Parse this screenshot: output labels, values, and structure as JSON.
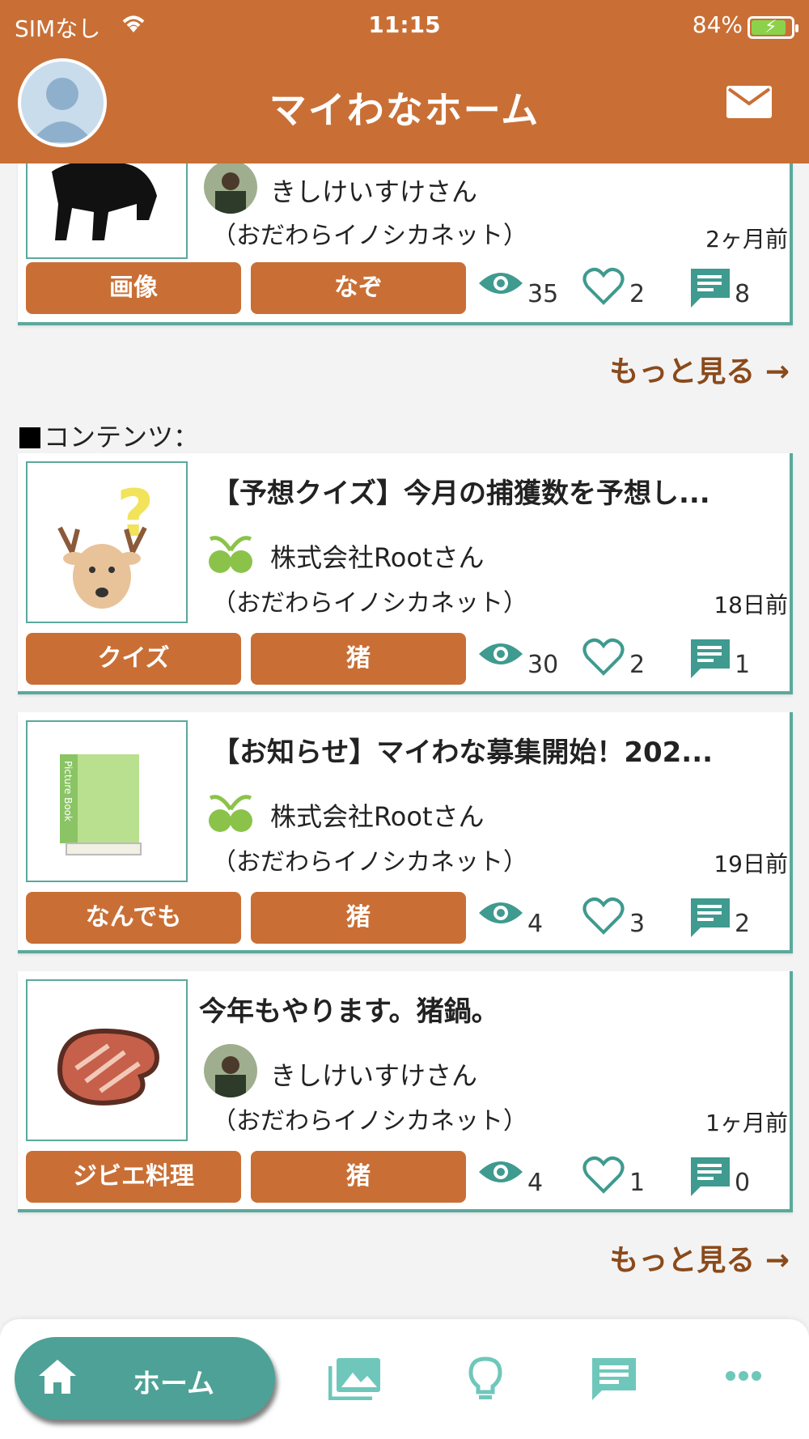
{
  "status_bar": {
    "carrier": "SIMなし",
    "time": "11:15",
    "battery": "84%"
  },
  "header": {
    "title": "マイわなホーム"
  },
  "top_card": {
    "author": "きしけいすけさん",
    "org": "（おだわらイノシカネット）",
    "ago": "2ヶ月前",
    "tags": [
      "画像",
      "なぞ"
    ],
    "views": "35",
    "likes": "2",
    "comments": "8"
  },
  "more_link_1": "もっと見る →",
  "section_label": "コンテンツ：",
  "contents": [
    {
      "title": "【予想クイズ】今月の捕獲数を予想し...",
      "author": "株式会社Rootさん",
      "org": "（おだわらイノシカネット）",
      "ago": "18日前",
      "tags": [
        "クイズ",
        "猪"
      ],
      "views": "30",
      "likes": "2",
      "comments": "1"
    },
    {
      "title": "【お知らせ】マイわな募集開始！202...",
      "author": "株式会社Rootさん",
      "org": "（おだわらイノシカネット）",
      "ago": "19日前",
      "tags": [
        "なんでも",
        "猪"
      ],
      "views": "4",
      "likes": "3",
      "comments": "2",
      "book_spine": "Picture Book"
    },
    {
      "title": "今年もやります。猪鍋。",
      "author": "きしけいすけさん",
      "org": "（おだわらイノシカネット）",
      "ago": "1ヶ月前",
      "tags": [
        "ジビエ料理",
        "猪"
      ],
      "views": "4",
      "likes": "1",
      "comments": "0"
    }
  ],
  "more_link_2": "もっと見る →",
  "bottom_nav": {
    "home_label": "ホーム",
    "items": [
      "gallery-icon",
      "lightbulb-icon",
      "chat-icon",
      "more-icon"
    ]
  },
  "colors": {
    "brand": "#c96f35",
    "accent": "#4ea196",
    "link": "#8b4a1a"
  }
}
